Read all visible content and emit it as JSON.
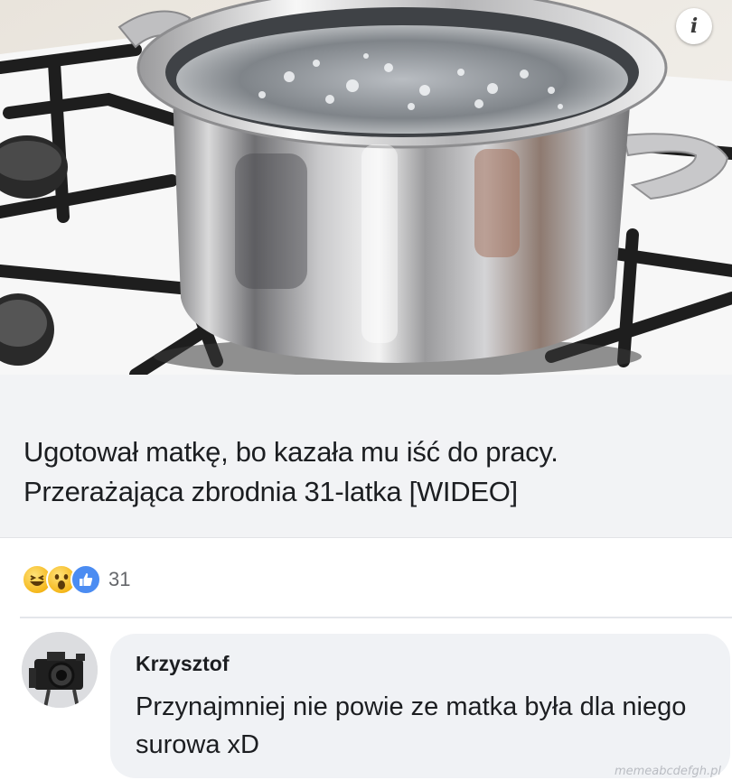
{
  "post": {
    "headline": "Ugotował matkę, bo kazała mu iść do pracy. Przerażająca zbrodnia 31-latka [WIDEO]",
    "info_icon": "i",
    "image_alt_icon": "pot-on-stove-image"
  },
  "reactions": {
    "icons": [
      "haha-reaction-icon",
      "wow-reaction-icon",
      "like-reaction-icon"
    ],
    "count": "31"
  },
  "comment": {
    "author": "Krzysztof",
    "text": "Przynajmniej nie powie ze matka była dla niego surowa xD",
    "avatar_icon": "camera-avatar-icon"
  },
  "watermark": "memeabcdefgh.pl",
  "colors": {
    "headline_bg": "#f2f3f5",
    "bubble_bg": "#f0f2f5",
    "like_blue": "#4b8cf2",
    "emoji_yellow": "#f5b81c",
    "text": "#1c1e21",
    "muted": "#65676b"
  }
}
